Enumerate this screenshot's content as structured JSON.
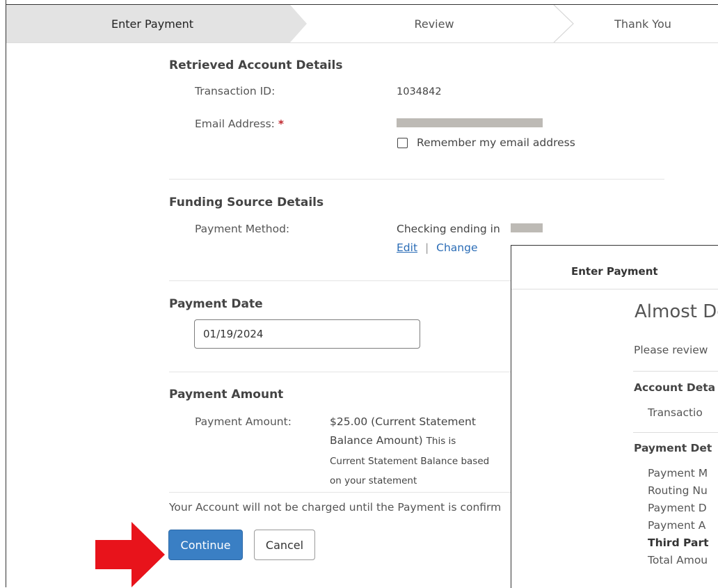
{
  "stepper": {
    "steps": [
      {
        "label": "Enter Payment",
        "active": true
      },
      {
        "label": "Review",
        "active": false
      },
      {
        "label": "Thank You",
        "active": false
      }
    ]
  },
  "account": {
    "title": "Retrieved Account Details",
    "transaction_label": "Transaction ID:",
    "transaction_value": "1034842",
    "email_label": "Email Address:",
    "required_mark": "*",
    "remember_label": "Remember my email address",
    "remember_checked": false
  },
  "funding": {
    "title": "Funding Source Details",
    "method_label": "Payment Method:",
    "method_value": "Checking ending in",
    "edit_link": "Edit",
    "separator": "|",
    "change_link": "Change"
  },
  "payment_date": {
    "title": "Payment Date",
    "value": "01/19/2024"
  },
  "payment_amount": {
    "title": "Payment Amount",
    "label": "Payment Amount:",
    "value_line1": "$25.00 (Current Statement",
    "value_line2": "Balance Amount)",
    "note_inline": "This is",
    "note_line2": "Current Statement Balance based",
    "note_line3": "on your statement"
  },
  "notice": "Your Account will not be charged until the Payment is confirm",
  "actions": {
    "continue_label": "Continue",
    "cancel_label": "Cancel"
  },
  "overlay": {
    "step_label": "Enter Payment",
    "title": "Almost Do",
    "text": "Please review",
    "account_section": "Account Deta",
    "transaction_row": "Transactio",
    "payment_section": "Payment Det",
    "rows": [
      "Payment M",
      "Routing Nu",
      "Payment D",
      "Payment A"
    ],
    "third_party": "Third Part",
    "total_row": "Total Amou"
  },
  "colors": {
    "accent": "#3a7fc4",
    "link": "#2a6cb6",
    "required": "#c0282e",
    "arrow": "#e8131b",
    "active_step_bg": "#e3e3e3"
  }
}
